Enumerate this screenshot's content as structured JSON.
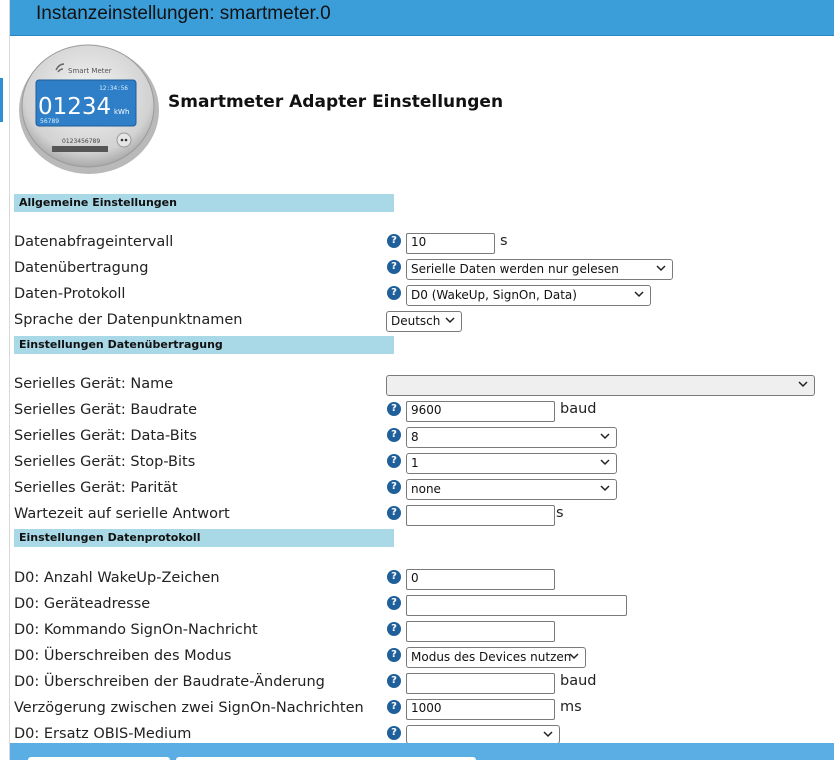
{
  "window": {
    "title": "Instanzeinstellungen: smartmeter.0"
  },
  "logo": {
    "brand": "Smart Meter",
    "time": "12:34:56",
    "reading": "01234",
    "unit": "kWh",
    "sub": "56789",
    "serial": "0123456789"
  },
  "page": {
    "title": "Smartmeter Adapter Einstellungen"
  },
  "sections": {
    "general": "Allgemeine Einstellungen",
    "transfer": "Einstellungen Datenübertragung",
    "protocol": "Einstellungen Datenprotokoll"
  },
  "fields": {
    "interval": {
      "label": "Datenabfrageintervall",
      "value": "10",
      "unit": "s"
    },
    "transfer_mode": {
      "label": "Datenübertragung",
      "value": "Serielle Daten werden nur gelesen"
    },
    "protocol": {
      "label": "Daten-Protokoll",
      "value": "D0 (WakeUp, SignOn, Data)"
    },
    "language": {
      "label": "Sprache der Datenpunktnamen",
      "value": "Deutsch"
    },
    "serial_name": {
      "label": "Serielles Gerät: Name",
      "value": ""
    },
    "baudrate": {
      "label": "Serielles Gerät: Baudrate",
      "value": "9600",
      "unit": "baud"
    },
    "databits": {
      "label": "Serielles Gerät: Data-Bits",
      "value": "8"
    },
    "stopbits": {
      "label": "Serielles Gerät: Stop-Bits",
      "value": "1"
    },
    "parity": {
      "label": "Serielles Gerät: Parität",
      "value": "none"
    },
    "response_wait": {
      "label": "Wartezeit auf serielle Antwort",
      "value": "",
      "unit": "s"
    },
    "wakeup_chars": {
      "label": "D0: Anzahl WakeUp-Zeichen",
      "value": "0"
    },
    "device_address": {
      "label": "D0: Geräteadresse",
      "value": ""
    },
    "signon_cmd": {
      "label": "D0: Kommando SignOn-Nachricht",
      "value": ""
    },
    "mode_override": {
      "label": "D0: Überschreiben des Modus",
      "value": "Modus des Devices nutzen"
    },
    "baud_override": {
      "label": "D0: Überschreiben der Baudrate-Änderung",
      "value": "",
      "unit": "baud"
    },
    "signon_delay": {
      "label": "Verzögerung zwischen zwei SignOn-Nachrichten",
      "value": "1000",
      "unit": "ms"
    },
    "obis_medium": {
      "label": "D0: Ersatz OBIS-Medium",
      "value": ""
    }
  },
  "help_glyph": "?",
  "colors": {
    "titlebar": "#3b9ed9",
    "section": "#a9d8e6",
    "help": "#1f5f9a"
  }
}
